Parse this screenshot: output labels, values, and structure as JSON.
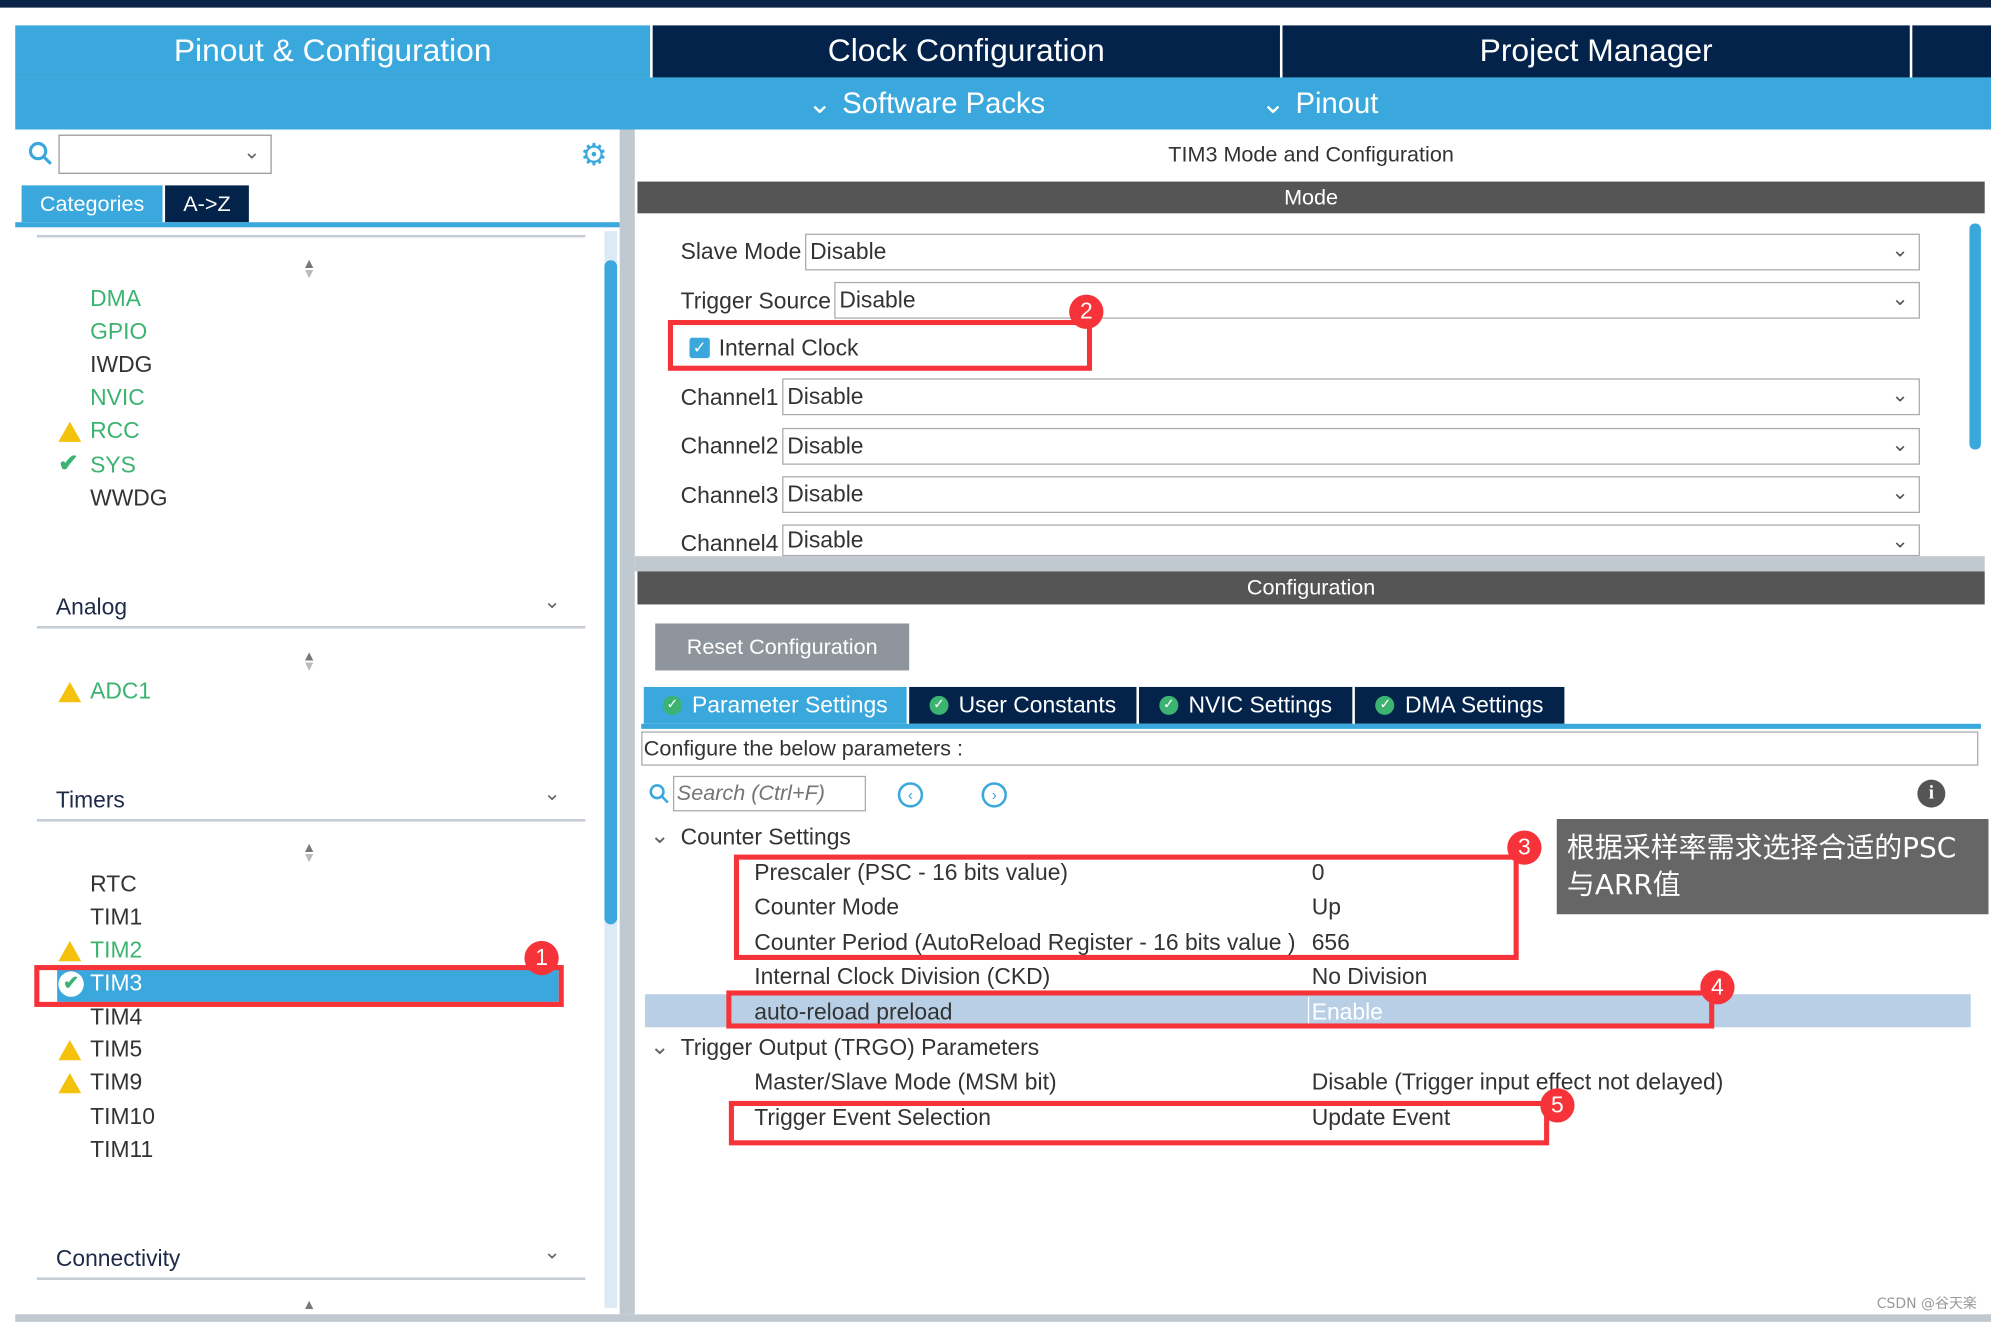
{
  "top_tabs": [
    {
      "label": "Pinout & Configuration",
      "active": true
    },
    {
      "label": "Clock Configuration"
    },
    {
      "label": "Project Manager"
    }
  ],
  "sub_menu": [
    {
      "label": "Software Packs"
    },
    {
      "label": "Pinout"
    }
  ],
  "sidebar": {
    "search_value": "",
    "view_tabs": [
      {
        "label": "Categories",
        "active": true
      },
      {
        "label": "A->Z"
      }
    ],
    "system_items": [
      {
        "label": "DMA",
        "status": "configured"
      },
      {
        "label": "GPIO",
        "status": "configured"
      },
      {
        "label": "IWDG"
      },
      {
        "label": "NVIC",
        "status": "configured"
      },
      {
        "label": "RCC",
        "status": "warning"
      },
      {
        "label": "SYS",
        "status": "ok"
      },
      {
        "label": "WWDG"
      }
    ],
    "categories": {
      "analog": "Analog",
      "timers": "Timers",
      "connectivity": "Connectivity"
    },
    "analog_items": [
      {
        "label": "ADC1",
        "status": "warning"
      }
    ],
    "timer_items": [
      {
        "label": "RTC"
      },
      {
        "label": "TIM1"
      },
      {
        "label": "TIM2",
        "status": "warning"
      },
      {
        "label": "TIM3",
        "status": "selected"
      },
      {
        "label": "TIM4"
      },
      {
        "label": "TIM5",
        "status": "warning"
      },
      {
        "label": "TIM9",
        "status": "warning"
      },
      {
        "label": "TIM10"
      },
      {
        "label": "TIM11"
      }
    ]
  },
  "main": {
    "title": "TIM3 Mode and Configuration",
    "mode_header": "Mode",
    "mode": {
      "slave_mode": {
        "label": "Slave Mode",
        "value": "Disable"
      },
      "trigger_source": {
        "label": "Trigger Source",
        "value": "Disable"
      },
      "internal_clock": {
        "label": "Internal Clock",
        "checked": true
      },
      "channels": [
        {
          "label": "Channel1",
          "value": "Disable"
        },
        {
          "label": "Channel2",
          "value": "Disable"
        },
        {
          "label": "Channel3",
          "value": "Disable"
        },
        {
          "label": "Channel4",
          "value": "Disable"
        }
      ]
    },
    "config_header": "Configuration",
    "reset_button": "Reset Configuration",
    "config_tabs": [
      {
        "label": "Parameter Settings",
        "active": true
      },
      {
        "label": "User Constants"
      },
      {
        "label": "NVIC Settings"
      },
      {
        "label": "DMA Settings"
      }
    ],
    "configure_hint": "Configure the below parameters :",
    "search_placeholder": "Search (Ctrl+F)",
    "groups": [
      {
        "label": "Counter Settings",
        "params": [
          {
            "name": "Prescaler (PSC - 16 bits value)",
            "value": "0"
          },
          {
            "name": "Counter Mode",
            "value": "Up"
          },
          {
            "name": "Counter Period (AutoReload Register - 16 bits value )",
            "value": "656"
          },
          {
            "name": "Internal Clock Division (CKD)",
            "value": "No Division"
          },
          {
            "name": "auto-reload preload",
            "value": "Enable"
          }
        ]
      },
      {
        "label": "Trigger Output (TRGO) Parameters",
        "params": [
          {
            "name": "Master/Slave Mode (MSM bit)",
            "value": "Disable (Trigger input effect not delayed)"
          },
          {
            "name": "Trigger Event Selection",
            "value": "Update Event"
          }
        ]
      }
    ]
  },
  "annotations": {
    "badges": [
      "1",
      "2",
      "3",
      "4",
      "5"
    ],
    "note": "根据采样率需求选择合适的PSC与ARR值",
    "color": "#f53338"
  },
  "watermark": "CSDN @谷天楽",
  "colors": {
    "accent": "#3aa8dc",
    "dark": "#03234b",
    "ok": "#3cb371",
    "warning": "#f4c20d"
  }
}
